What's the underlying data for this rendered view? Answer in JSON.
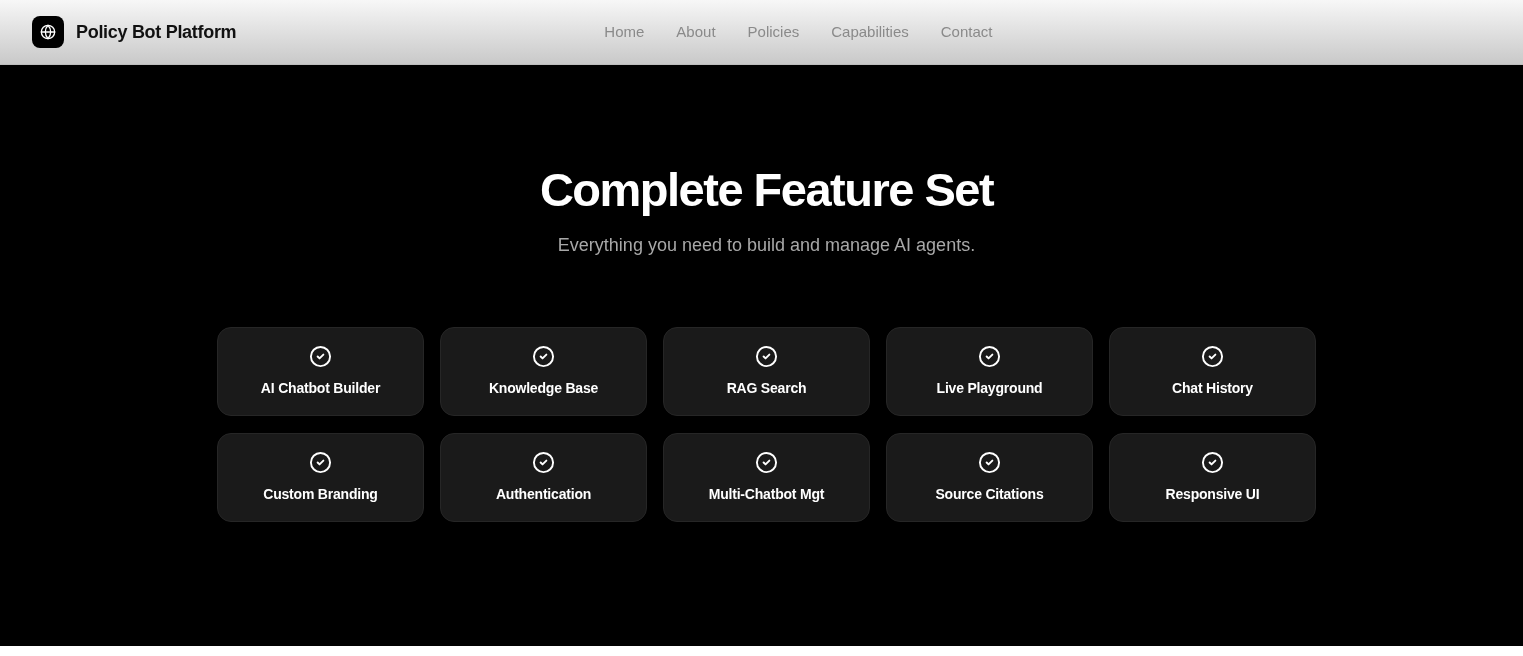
{
  "header": {
    "brand": "Policy Bot Platform",
    "nav": [
      "Home",
      "About",
      "Policies",
      "Capabilities",
      "Contact"
    ]
  },
  "hero": {
    "title": "Complete Feature Set",
    "subtitle": "Everything you need to build and manage AI agents."
  },
  "features": [
    "AI Chatbot Builder",
    "Knowledge Base",
    "RAG Search",
    "Live Playground",
    "Chat History",
    "Custom Branding",
    "Authentication",
    "Multi-Chatbot Mgt",
    "Source Citations",
    "Responsive UI"
  ]
}
